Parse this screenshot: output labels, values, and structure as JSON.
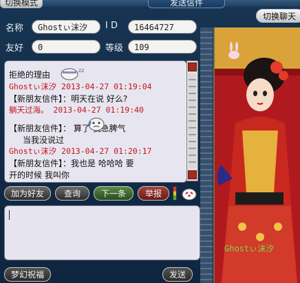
{
  "tabs": {
    "mode": "切换模式",
    "send": "发送信件"
  },
  "header": {
    "name_label": "名称",
    "name_value": "Ghostぃ沫汐",
    "id_label": "I D",
    "id_value": "16464727",
    "friend_label": "友好",
    "friend_value": "0",
    "level_label": "等级",
    "level_value": "109",
    "switch_chat": "切换聊天"
  },
  "messages": [
    {
      "text": "拒绝的理由",
      "color": "black"
    },
    {
      "text": "Ghostぃ沫汐 2013-04-27 01:19:04",
      "color": "red"
    },
    {
      "text": "【新朋友信件】：明天在说  好么?",
      "color": "black"
    },
    {
      "text": "躺天过海。 2013-04-27 01:19:40",
      "color": "red"
    },
    {
      "text": "【新朋友信件】：      算了   我急脾气",
      "color": "black"
    },
    {
      "text": "当我没说过",
      "color": "black"
    },
    {
      "text": "Ghostぃ沫汐 2013-04-27 01:20:17",
      "color": "red"
    },
    {
      "text": "【新朋友信件】：我也是   哈哈哈   要",
      "color": "black"
    },
    {
      "text": "开的时候  我叫你",
      "color": "black"
    }
  ],
  "actions": {
    "add_friend": "加为好友",
    "inquire": "查询",
    "next": "下一条",
    "report": "举报"
  },
  "footer": {
    "blessing": "梦幻祝福",
    "send": "发送"
  },
  "portrait": {
    "name": "Ghostぃ沫汐"
  },
  "colors": {
    "accent_red": "#c5141b",
    "panel": "#e7e6f0",
    "bg": "#173553"
  }
}
